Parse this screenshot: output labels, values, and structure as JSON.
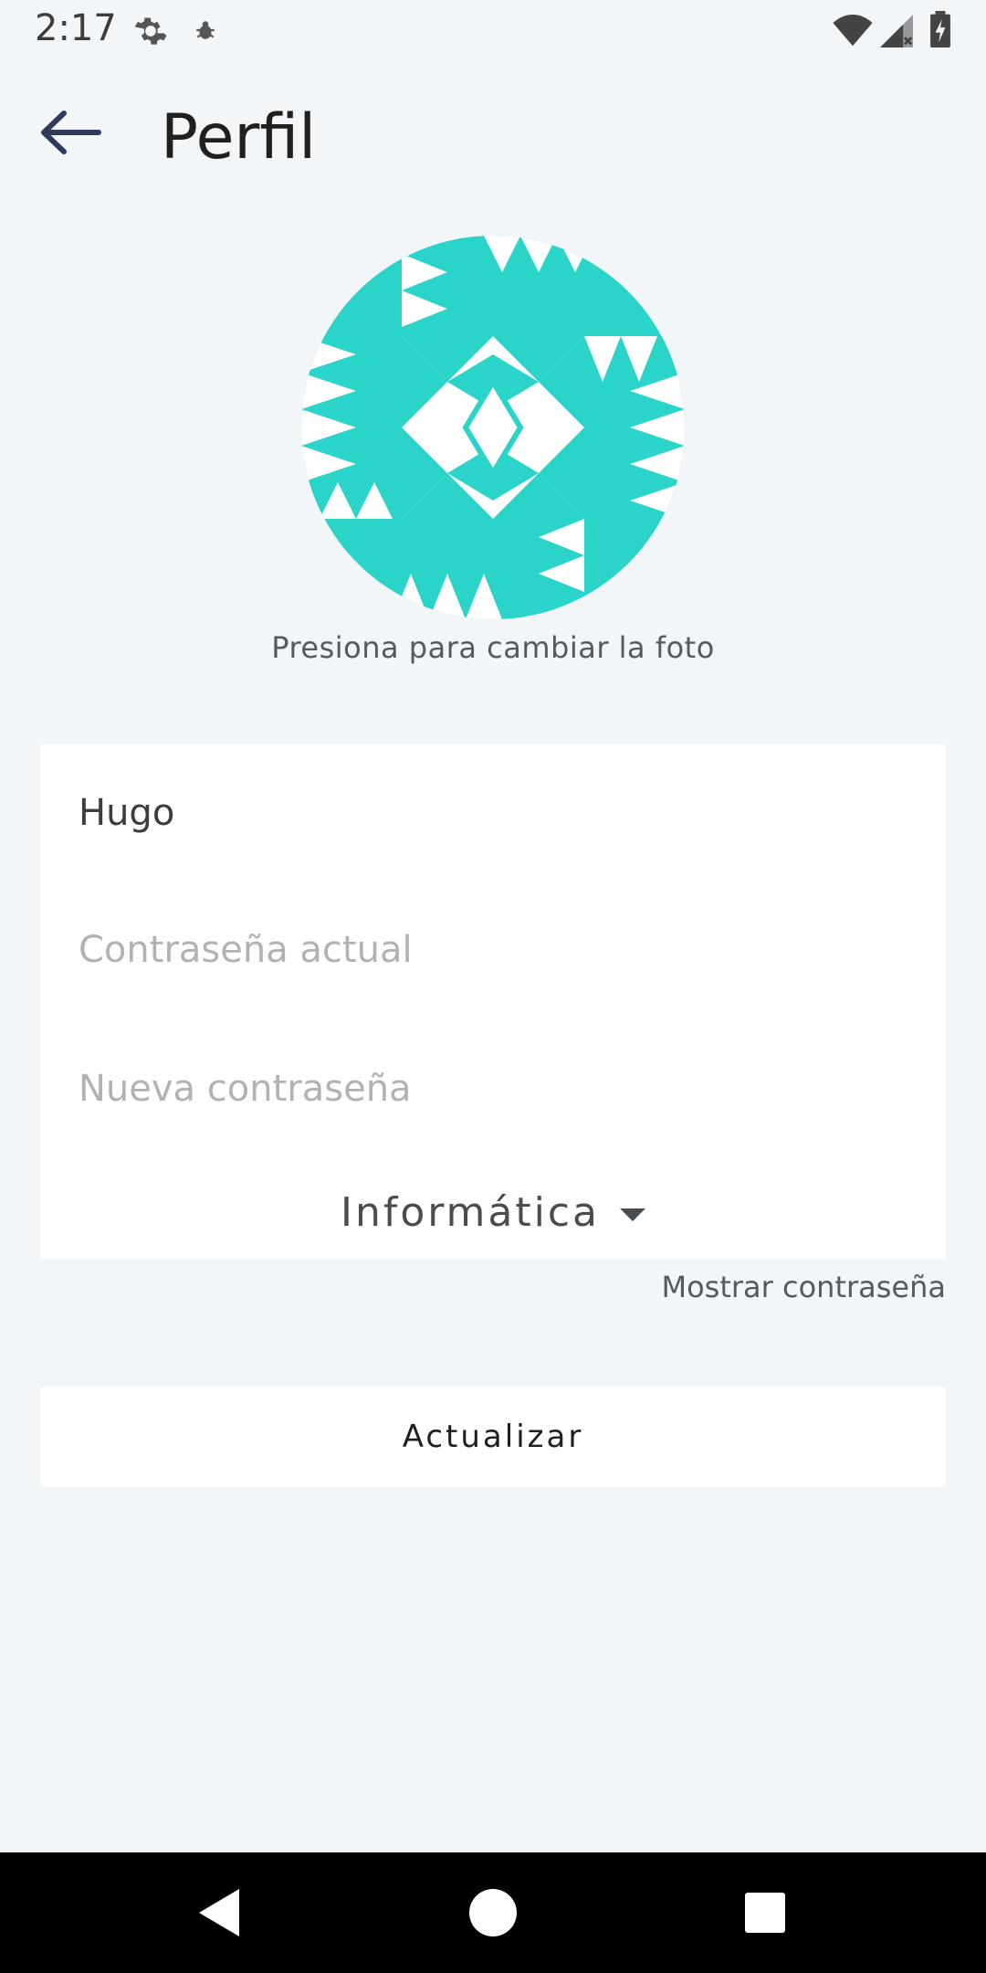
{
  "status_bar": {
    "time": "2:17",
    "icons": [
      "settings-icon",
      "bug-icon",
      "wifi-icon",
      "signal-icon",
      "battery-charging-icon"
    ]
  },
  "header": {
    "back_icon": "arrow-left-icon",
    "title": "Perfil"
  },
  "avatar": {
    "hint": "Presiona para cambiar la foto",
    "pattern_color": "#2bd4c8"
  },
  "form": {
    "username_value": "Hugo",
    "current_password_placeholder": "Contraseña actual",
    "new_password_placeholder": "Nueva contraseña",
    "department_selected": "Informática",
    "show_password_label": "Mostrar contraseña"
  },
  "actions": {
    "update_label": "Actualizar"
  },
  "nav_bar": {
    "icons": [
      "back-triangle-icon",
      "home-circle-icon",
      "recents-square-icon"
    ]
  },
  "colors": {
    "background": "#f3f6f9",
    "card": "#ffffff",
    "accent": "#2bd4c8",
    "nav_bar": "#000000"
  }
}
